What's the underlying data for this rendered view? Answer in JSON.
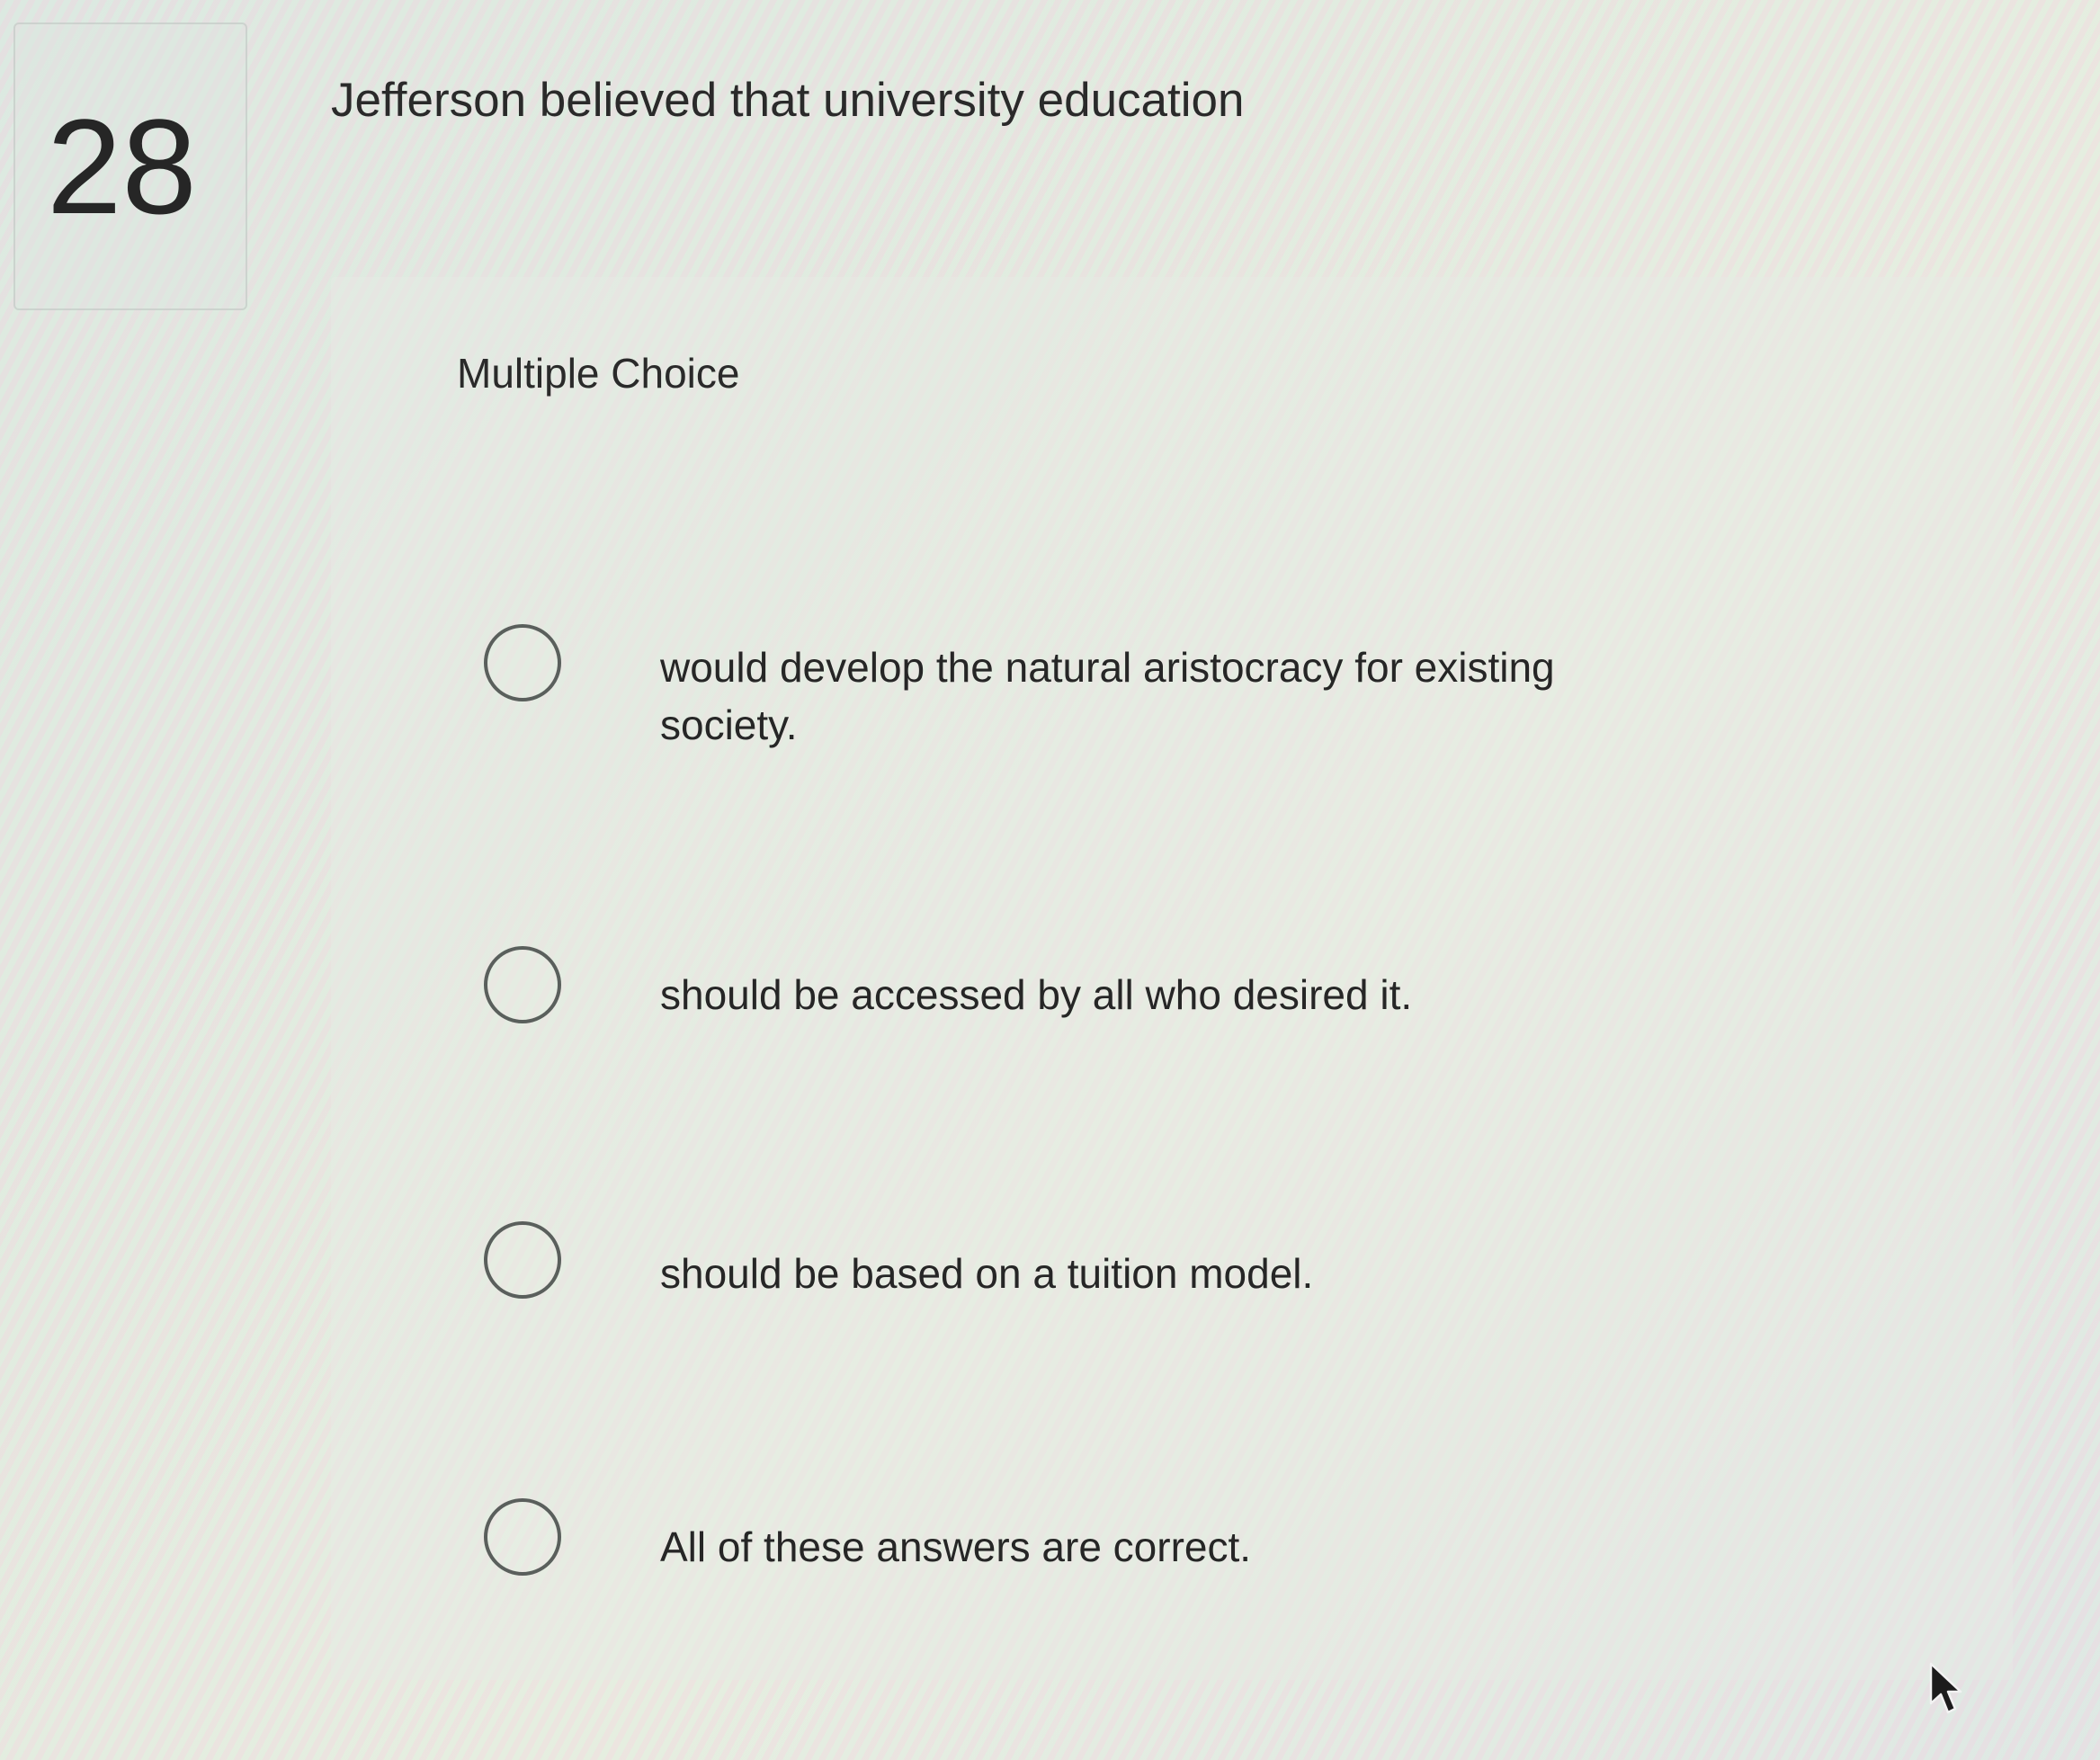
{
  "question": {
    "number": "28",
    "text": "Jefferson believed that university education",
    "type_label": "Multiple Choice"
  },
  "options": [
    {
      "label": "would develop the natural aristocracy for existing society.",
      "selected": false
    },
    {
      "label": "should be accessed by all who desired it.",
      "selected": false
    },
    {
      "label": "should be based on a tuition model.",
      "selected": false
    },
    {
      "label": "All of these answers are correct.",
      "selected": false
    }
  ],
  "icons": {
    "radio": "radio-circle-icon",
    "cursor": "mouse-pointer-icon"
  }
}
